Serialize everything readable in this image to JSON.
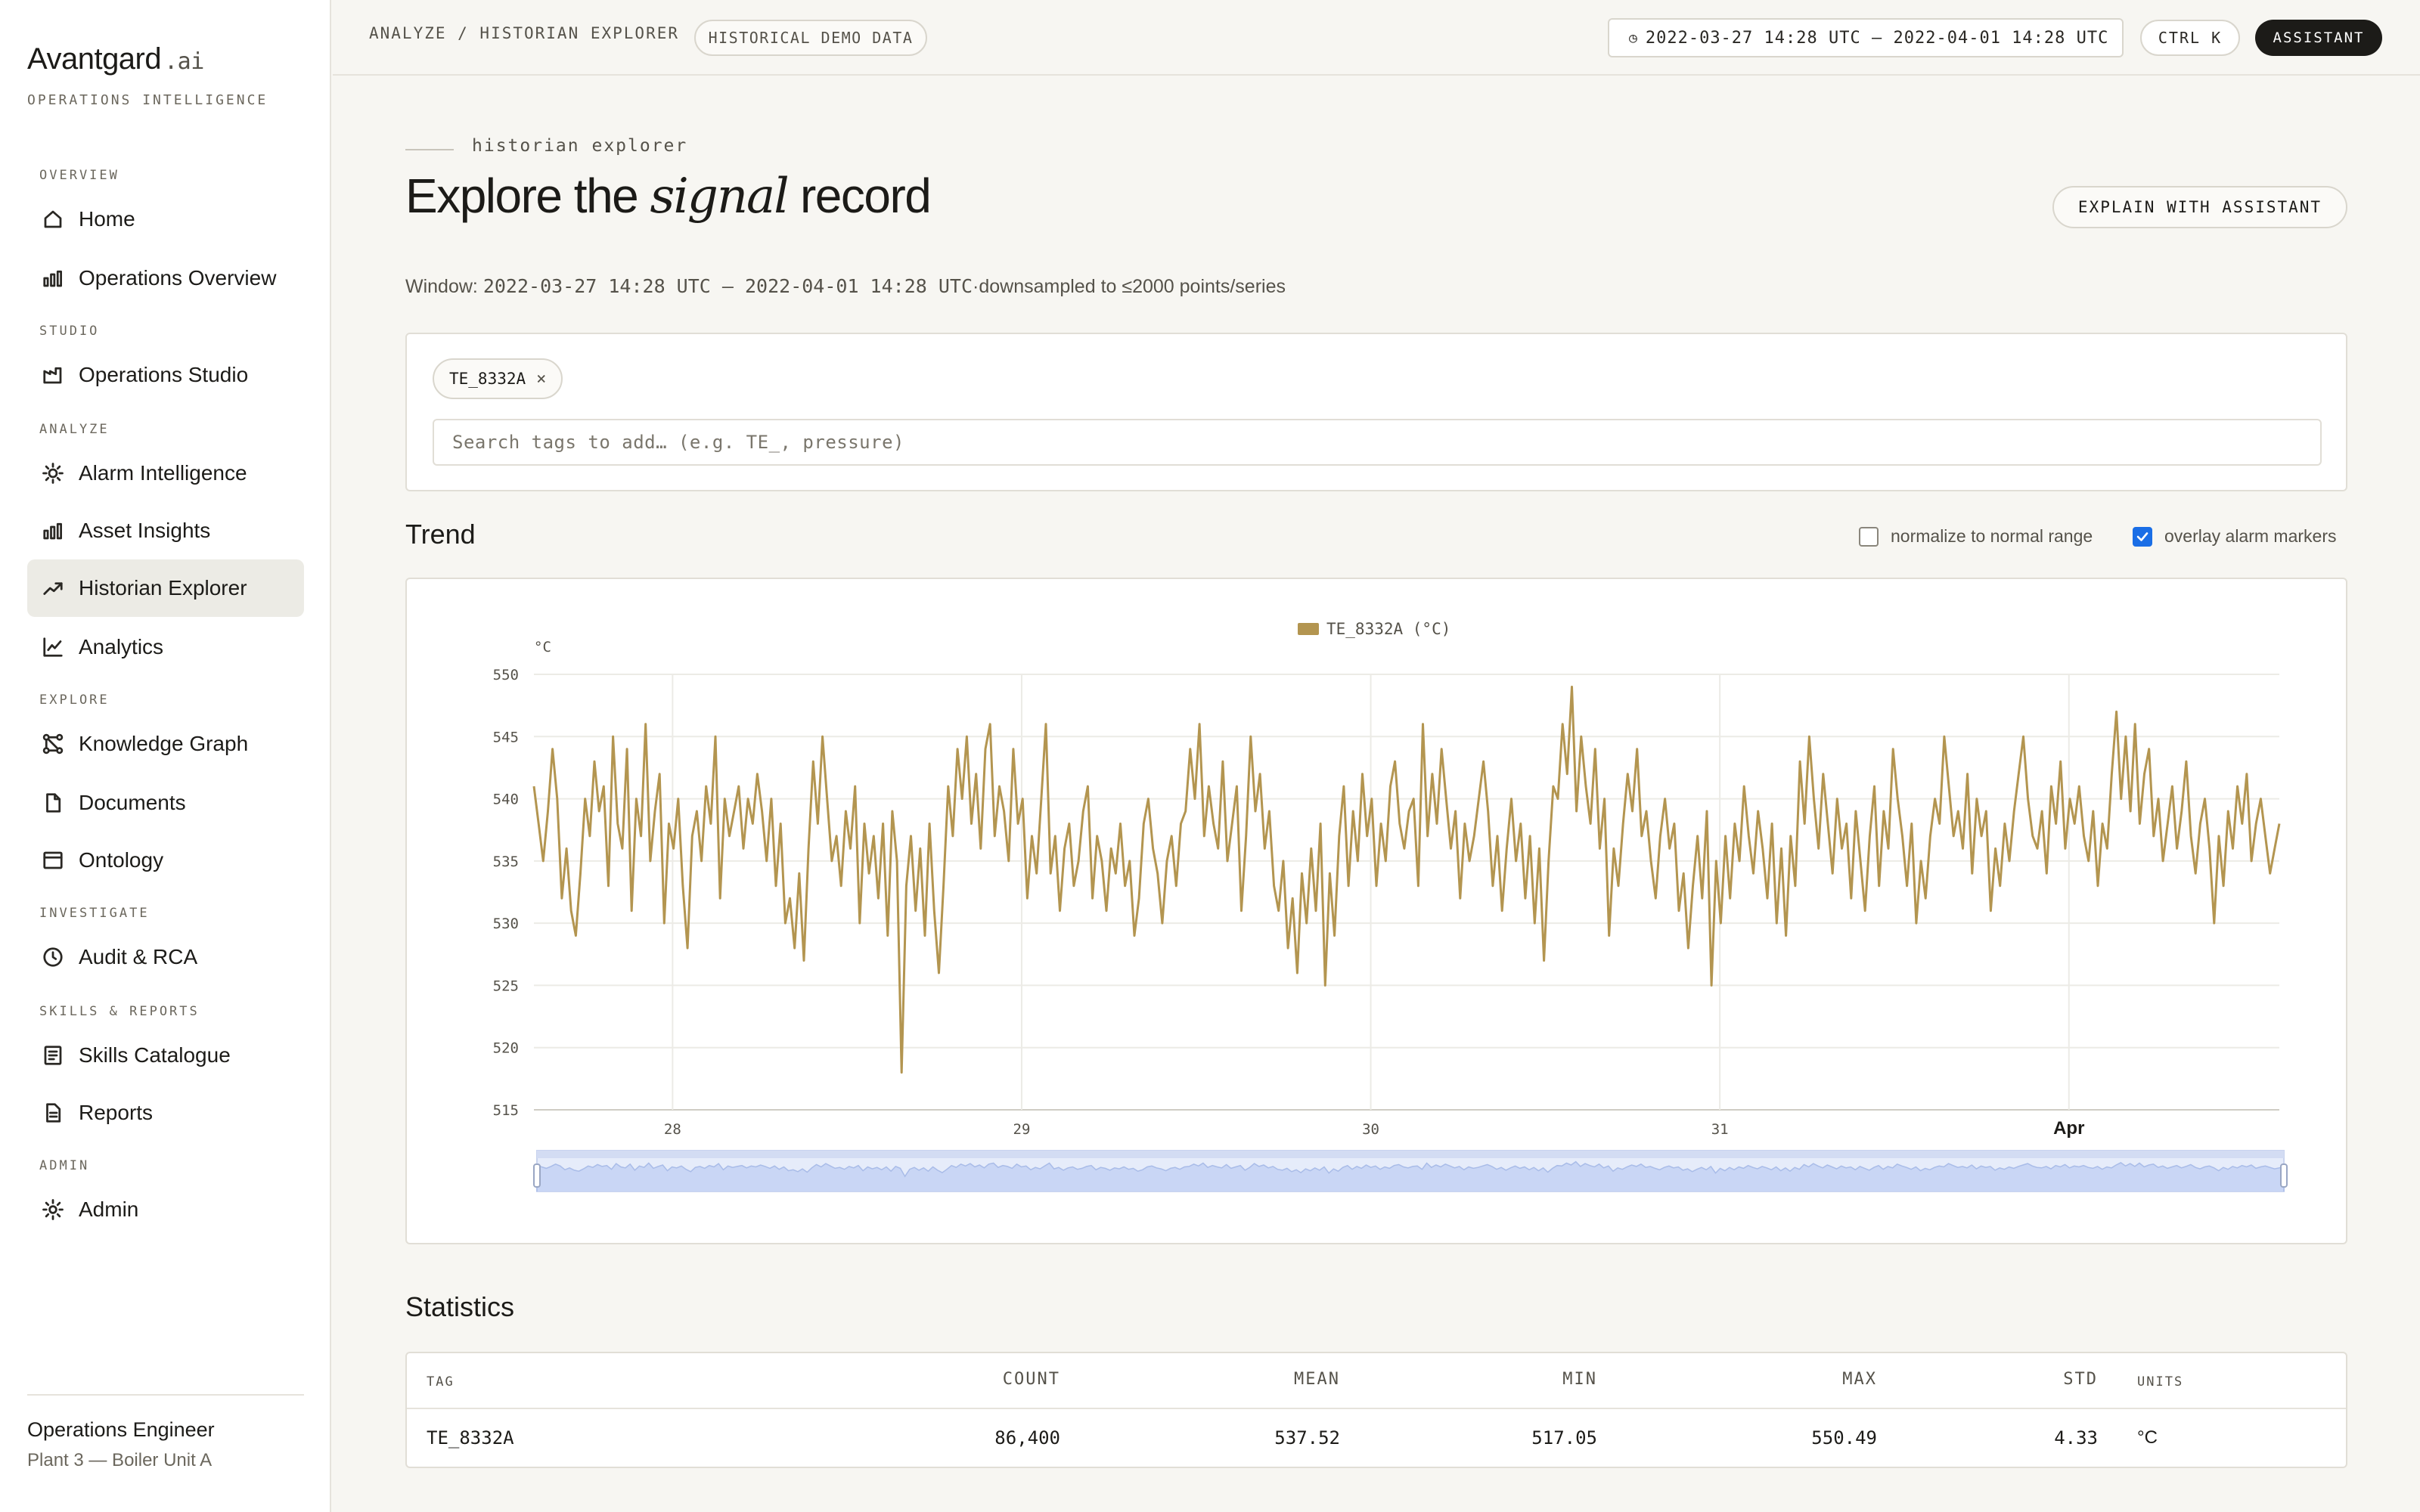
{
  "app": {
    "brand": "Avantgard",
    "brand_suffix": ".ai",
    "brand_subtitle": "OPERATIONS INTELLIGENCE"
  },
  "sidebar": {
    "sections": [
      {
        "label": "OVERVIEW"
      },
      {
        "label": "STUDIO"
      },
      {
        "label": "ANALYZE"
      },
      {
        "label": "EXPLORE"
      },
      {
        "label": "INVESTIGATE"
      },
      {
        "label": "SKILLS & REPORTS"
      },
      {
        "label": "ADMIN"
      }
    ],
    "items": [
      {
        "label": "Home",
        "icon": "home-icon"
      },
      {
        "label": "Operations Overview",
        "icon": "bar-chart-icon"
      },
      {
        "label": "Operations Studio",
        "icon": "factory-icon"
      },
      {
        "label": "Alarm Intelligence",
        "icon": "sun-icon"
      },
      {
        "label": "Asset Insights",
        "icon": "bar-chart-icon"
      },
      {
        "label": "Historian Explorer",
        "icon": "trend-line-icon",
        "active": true
      },
      {
        "label": "Analytics",
        "icon": "line-chart-icon"
      },
      {
        "label": "Knowledge Graph",
        "icon": "graph-nodes-icon"
      },
      {
        "label": "Documents",
        "icon": "document-icon"
      },
      {
        "label": "Ontology",
        "icon": "archive-box-icon"
      },
      {
        "label": "Audit & RCA",
        "icon": "clock-icon"
      },
      {
        "label": "Skills Catalogue",
        "icon": "list-icon"
      },
      {
        "label": "Reports",
        "icon": "report-icon"
      },
      {
        "label": "Admin",
        "icon": "gear-icon"
      }
    ],
    "user": {
      "role": "Operations Engineer",
      "plant": "Plant 3 — Boiler Unit A"
    }
  },
  "topbar": {
    "breadcrumb": "ANALYZE / HISTORIAN EXPLORER",
    "badge": "HISTORICAL DEMO DATA",
    "time_range": "2022-03-27 14:28 UTC – 2022-04-01 14:28 UTC",
    "shortcut": "CTRL K",
    "assistant": "ASSISTANT"
  },
  "header": {
    "eyebrow": "historian explorer",
    "title_start": "Explore the ",
    "title_emphasis": "signal",
    "title_end": " record",
    "explain_button": "EXPLAIN WITH ASSISTANT",
    "window_label": "Window: ",
    "window_range": "2022-03-27 14:28 UTC – 2022-04-01 14:28 UTC",
    "window_suffix": "·downsampled to ≤2000 points/series"
  },
  "tags": {
    "selected": [
      "TE_8332A"
    ],
    "remove_glyph": "×",
    "search_placeholder": "Search tags to add… (e.g. TE_, pressure)"
  },
  "trend": {
    "title": "Trend",
    "normalize_label": "normalize to normal range",
    "normalize_checked": false,
    "overlay_label": "overlay alarm markers",
    "overlay_checked": true
  },
  "chart_data": {
    "type": "line",
    "legend": "TE_8332A (°C)",
    "ylabel": "°C",
    "ylim": [
      515,
      550
    ],
    "yticks": [
      550,
      545,
      540,
      535,
      530,
      525,
      520,
      515
    ],
    "xticks": [
      "28",
      "29",
      "30",
      "31",
      "Apr"
    ],
    "xticks_bold": [
      "Apr"
    ],
    "x_range_days": [
      "2022-03-27 14:28",
      "2022-04-01 14:28"
    ],
    "series_color": "#b39550",
    "series": [
      {
        "name": "TE_8332A (°C)",
        "values": [
          541,
          538,
          535,
          539,
          544,
          540,
          532,
          536,
          531,
          529,
          534,
          540,
          537,
          543,
          539,
          541,
          533,
          545,
          538,
          536,
          544,
          531,
          540,
          537,
          546,
          535,
          539,
          542,
          530,
          538,
          536,
          540,
          533,
          528,
          537,
          539,
          535,
          541,
          538,
          545,
          532,
          540,
          537,
          539,
          541,
          536,
          540,
          538,
          542,
          539,
          535,
          540,
          533,
          538,
          530,
          532,
          528,
          534,
          527,
          536,
          543,
          538,
          545,
          540,
          535,
          537,
          533,
          539,
          536,
          541,
          530,
          538,
          534,
          537,
          532,
          538,
          529,
          539,
          535,
          518,
          533,
          537,
          531,
          536,
          529,
          538,
          531,
          526,
          533,
          541,
          537,
          544,
          540,
          545,
          538,
          542,
          536,
          544,
          546,
          537,
          541,
          539,
          535,
          544,
          538,
          540,
          532,
          537,
          534,
          540,
          546,
          534,
          537,
          531,
          536,
          538,
          533,
          535,
          539,
          541,
          532,
          537,
          535,
          531,
          536,
          534,
          538,
          533,
          535,
          529,
          532,
          538,
          540,
          536,
          534,
          530,
          535,
          537,
          533,
          538,
          539,
          544,
          540,
          546,
          537,
          541,
          538,
          536,
          543,
          535,
          538,
          541,
          531,
          537,
          545,
          539,
          542,
          536,
          539,
          533,
          531,
          535,
          528,
          532,
          526,
          534,
          530,
          536,
          531,
          538,
          525,
          534,
          529,
          537,
          541,
          533,
          539,
          535,
          542,
          537,
          540,
          533,
          538,
          535,
          541,
          543,
          538,
          536,
          539,
          540,
          533,
          546,
          537,
          542,
          538,
          544,
          540,
          536,
          539,
          532,
          538,
          535,
          537,
          540,
          543,
          539,
          533,
          537,
          531,
          536,
          540,
          535,
          538,
          532,
          537,
          530,
          536,
          527,
          535,
          541,
          540,
          546,
          542,
          549,
          539,
          545,
          541,
          538,
          544,
          536,
          540,
          529,
          536,
          533,
          538,
          542,
          539,
          544,
          537,
          539,
          535,
          532,
          537,
          540,
          536,
          538,
          531,
          534,
          528,
          533,
          537,
          532,
          539,
          525,
          535,
          530,
          537,
          532,
          538,
          535,
          541,
          537,
          534,
          539,
          536,
          532,
          538,
          530,
          536,
          529,
          537,
          533,
          543,
          538,
          545,
          540,
          536,
          542,
          538,
          534,
          540,
          536,
          538,
          532,
          539,
          535,
          531,
          537,
          541,
          533,
          539,
          536,
          544,
          540,
          537,
          533,
          538,
          530,
          535,
          532,
          537,
          540,
          538,
          545,
          541,
          537,
          539,
          536,
          542,
          534,
          540,
          537,
          539,
          531,
          536,
          533,
          538,
          535,
          539,
          542,
          545,
          540,
          537,
          536,
          539,
          534,
          541,
          538,
          543,
          536,
          540,
          538,
          541,
          537,
          535,
          539,
          533,
          538,
          536,
          542,
          547,
          540,
          545,
          539,
          546,
          538,
          542,
          544,
          537,
          540,
          535,
          538,
          541,
          536,
          539,
          543,
          537,
          534,
          538,
          540,
          536,
          530,
          537,
          533,
          539,
          536,
          541,
          538,
          542,
          535,
          538,
          540,
          537,
          534,
          536,
          538
        ]
      }
    ]
  },
  "statistics": {
    "title": "Statistics",
    "columns": [
      "TAG",
      "COUNT",
      "MEAN",
      "MIN",
      "MAX",
      "STD",
      "UNITS"
    ],
    "rows": [
      {
        "tag": "TE_8332A",
        "count": "86,400",
        "mean": "537.52",
        "min": "517.05",
        "max": "550.49",
        "std": "4.33",
        "units": "°C"
      }
    ]
  }
}
